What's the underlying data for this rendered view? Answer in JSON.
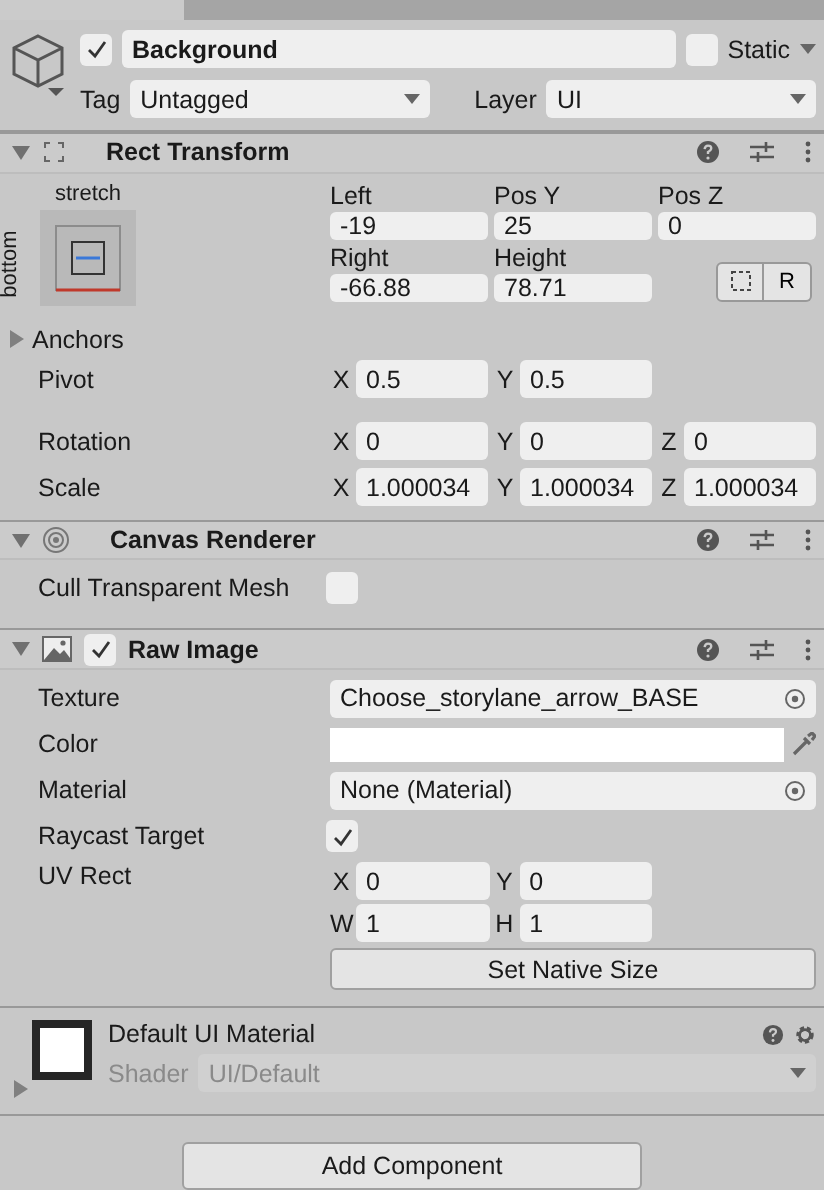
{
  "object": {
    "active": true,
    "name": "Background",
    "static_label": "Static",
    "static": false,
    "tag_label": "Tag",
    "tag": "Untagged",
    "layer_label": "Layer",
    "layer": "UI"
  },
  "rect_transform": {
    "title": "Rect Transform",
    "expanded": true,
    "anchor_horizontal": "stretch",
    "anchor_vertical": "bottom",
    "fields": [
      {
        "label": "Left",
        "value": "-19"
      },
      {
        "label": "Pos Y",
        "value": "25"
      },
      {
        "label": "Pos Z",
        "value": "0"
      },
      {
        "label": "Right",
        "value": "-66.88"
      },
      {
        "label": "Height",
        "value": "78.71"
      }
    ],
    "raw_button": "R",
    "anchors": {
      "label": "Anchors",
      "expanded": false
    },
    "vector_rows": [
      {
        "label": "Pivot",
        "axes": [
          {
            "axis": "X",
            "value": "0.5"
          },
          {
            "axis": "Y",
            "value": "0.5"
          }
        ]
      },
      {
        "label": "Rotation",
        "axes": [
          {
            "axis": "X",
            "value": "0"
          },
          {
            "axis": "Y",
            "value": "0"
          },
          {
            "axis": "Z",
            "value": "0"
          }
        ]
      },
      {
        "label": "Scale",
        "axes": [
          {
            "axis": "X",
            "value": "1.000034"
          },
          {
            "axis": "Y",
            "value": "1.000034"
          },
          {
            "axis": "Z",
            "value": "1.000034"
          }
        ]
      }
    ]
  },
  "canvas_renderer": {
    "title": "Canvas Renderer",
    "expanded": true,
    "cull_label": "Cull Transparent Mesh",
    "cull": false
  },
  "raw_image": {
    "title": "Raw Image",
    "expanded": true,
    "enabled": true,
    "texture_label": "Texture",
    "texture": "Choose_storylane_arrow_BASE",
    "color_label": "Color",
    "color": "#ffffff",
    "material_label": "Material",
    "material": "None (Material)",
    "raycast_label": "Raycast Target",
    "raycast": true,
    "uv_label": "UV Rect",
    "uv": [
      {
        "axis": "X",
        "value": "0"
      },
      {
        "axis": "Y",
        "value": "0"
      },
      {
        "axis": "W",
        "value": "1"
      },
      {
        "axis": "H",
        "value": "1"
      }
    ],
    "native_button": "Set Native Size"
  },
  "material": {
    "name": "Default UI Material",
    "shader_label": "Shader",
    "shader": "UI/Default",
    "expanded": false
  },
  "add_component": "Add Component"
}
